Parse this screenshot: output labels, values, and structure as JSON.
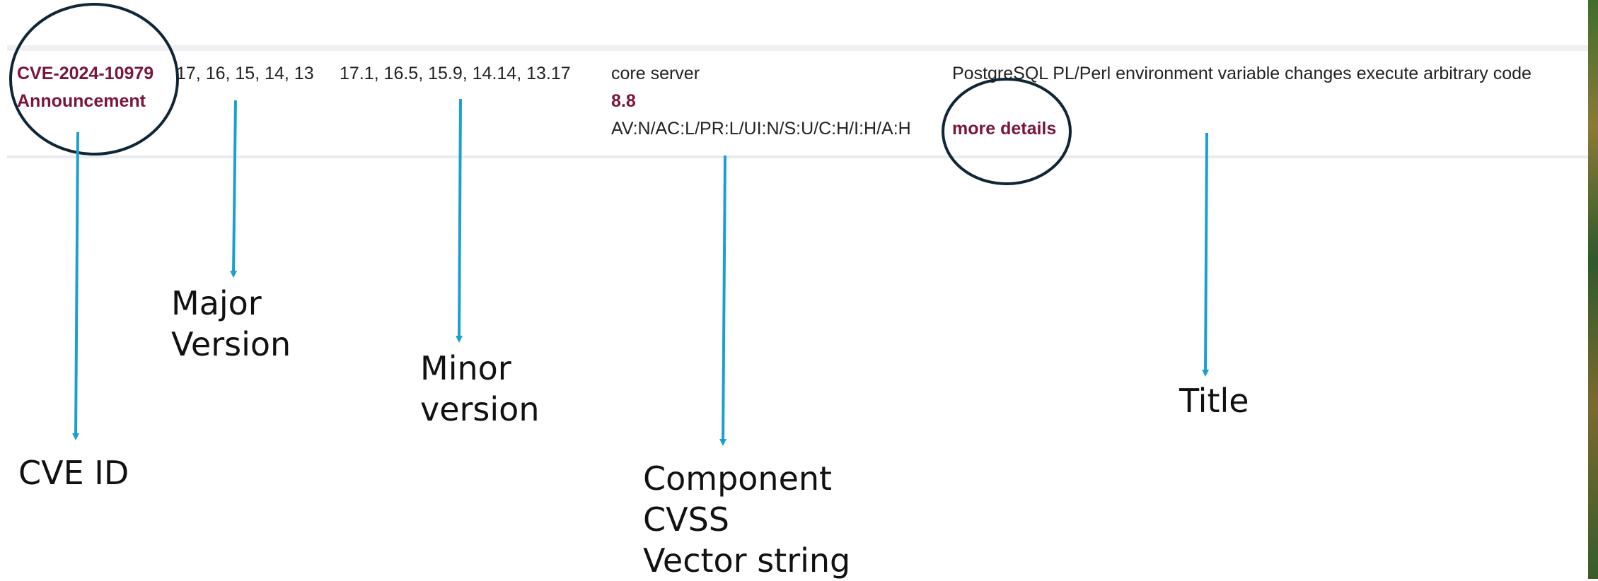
{
  "cve_row": {
    "cve_id": "CVE-2024-10979",
    "announcement_link": "Announcement",
    "major_versions": "17, 16, 15, 14, 13",
    "minor_versions": "17.1, 16.5, 15.9, 14.14, 13.17",
    "component": "core server",
    "cvss_score": "8.8",
    "vector_string": "AV:N/AC:L/PR:L/UI:N/S:U/C:H/I:H/A:H",
    "title": "PostgreSQL PL/Perl environment variable changes execute arbitrary code",
    "more_details_link": "more details"
  },
  "annotations": {
    "cve_id": "CVE ID",
    "major_version": [
      "Major",
      "Version"
    ],
    "minor_version": [
      "Minor",
      "version"
    ],
    "component_cvss_vector": [
      "Component",
      "CVSS",
      "Vector string"
    ],
    "title": "Title"
  },
  "colors": {
    "link": "#7a1636",
    "arrow": "#1b9fd0",
    "circle": "#0e2636"
  }
}
